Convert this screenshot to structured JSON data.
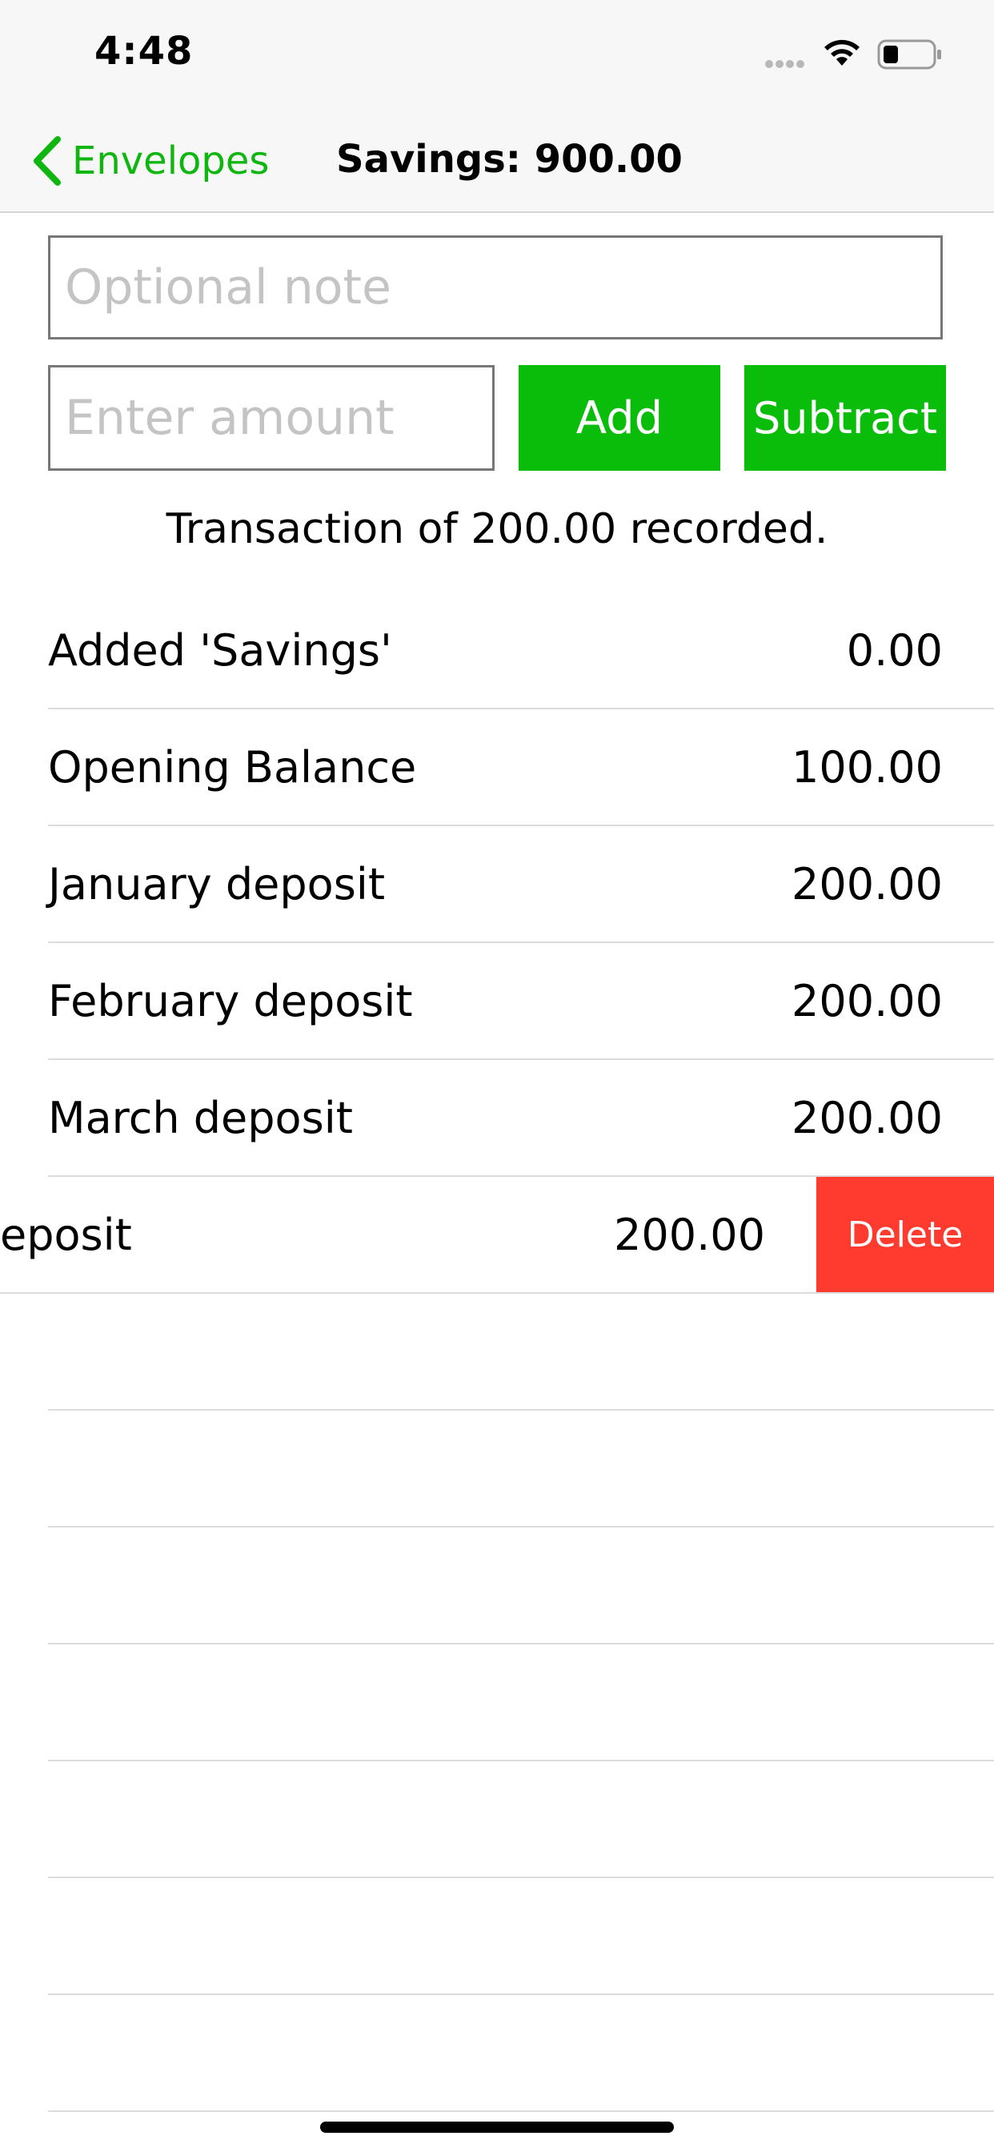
{
  "status_bar": {
    "time": "4:48"
  },
  "nav": {
    "back_label": "Envelopes",
    "title": "Savings: 900.00"
  },
  "form": {
    "note_placeholder": "Optional note",
    "amount_placeholder": "Enter amount",
    "add_label": "Add",
    "subtract_label": "Subtract"
  },
  "status_message": "Transaction of 200.00 recorded.",
  "transactions": [
    {
      "label": "Added 'Savings'",
      "amount": "0.00"
    },
    {
      "label": "Opening Balance",
      "amount": "100.00"
    },
    {
      "label": "January deposit",
      "amount": "200.00"
    },
    {
      "label": "February deposit",
      "amount": "200.00"
    },
    {
      "label": "March deposit",
      "amount": "200.00"
    },
    {
      "label": "eposit",
      "amount": "200.00"
    }
  ],
  "swipe_action": {
    "delete_label": "Delete"
  },
  "colors": {
    "accent_green": "#0bbd0b",
    "delete_red": "#ff3b30"
  }
}
